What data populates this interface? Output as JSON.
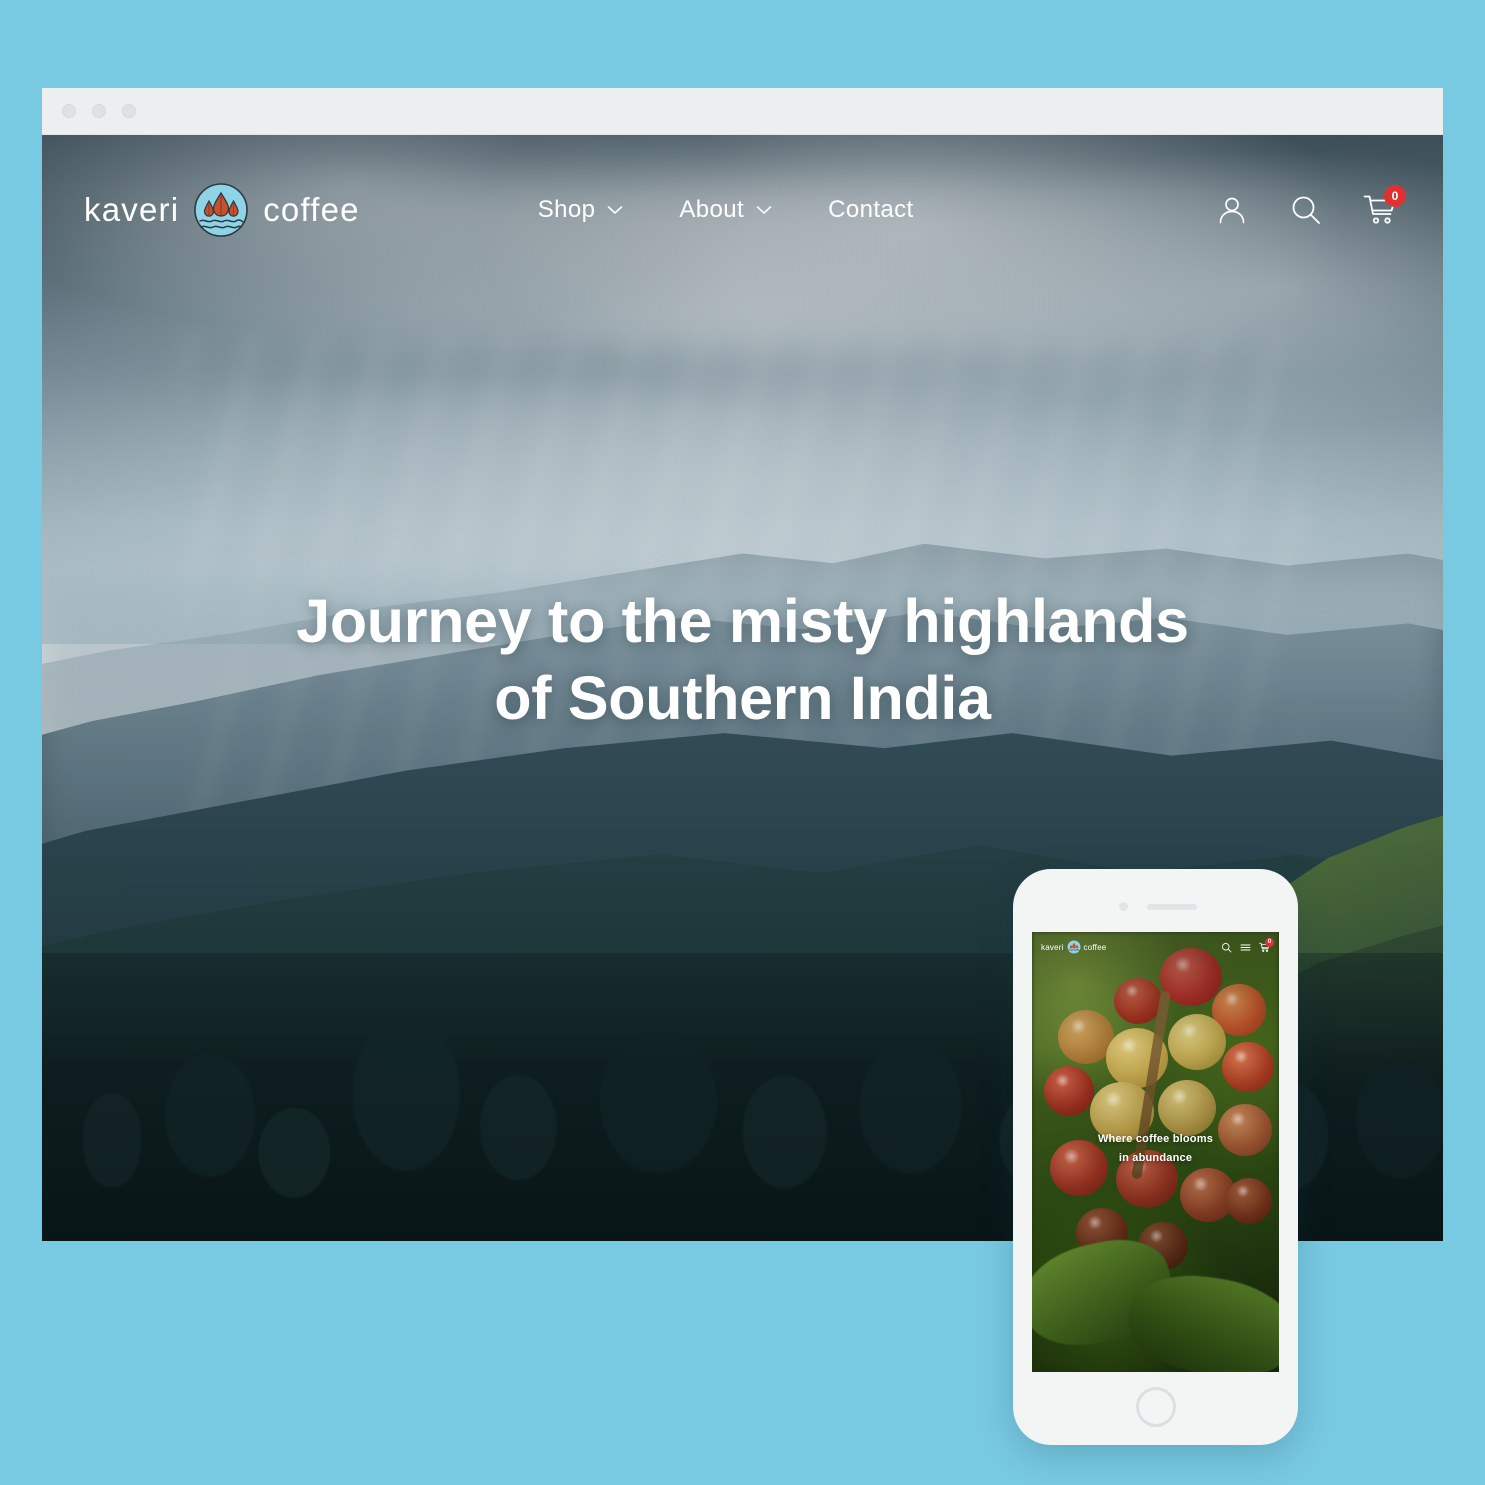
{
  "page": {
    "background_color": "#78c9e2"
  },
  "browser": {
    "window_dots": [
      "dot-1",
      "dot-2",
      "dot-3"
    ],
    "chrome_color": "#eceef0"
  },
  "desktop": {
    "brand": {
      "word_left": "kaveri",
      "word_right": "coffee",
      "logo_icon": "water-droplet-leaf-circle-logo",
      "logo_circle_color": "#8ed3e6",
      "logo_leaf_color": "#c8502b"
    },
    "nav": {
      "items": [
        {
          "label": "Shop",
          "has_dropdown": true,
          "icon": "chevron-down-icon"
        },
        {
          "label": "About",
          "has_dropdown": true,
          "icon": "chevron-down-icon"
        },
        {
          "label": "Contact",
          "has_dropdown": false,
          "icon": ""
        }
      ],
      "icons": [
        {
          "name": "account-icon",
          "label": "Account"
        },
        {
          "name": "search-icon",
          "label": "Search"
        },
        {
          "name": "cart-icon",
          "label": "Cart"
        }
      ],
      "cart_badge_count": "0",
      "cart_badge_color": "#e03131"
    },
    "hero": {
      "headline_line1": "Journey to the misty highlands",
      "headline_line2": "of Southern India",
      "image_alt": "misty blue mountain highlands with forested slopes and sun rays",
      "text_color": "#ffffff"
    }
  },
  "mobile": {
    "brand": {
      "word_left": "kaveri",
      "word_right": "coffee",
      "logo_icon": "water-droplet-leaf-circle-logo"
    },
    "nav": {
      "icons": [
        {
          "name": "search-icon",
          "label": "Search"
        },
        {
          "name": "hamburger-menu-icon",
          "label": "Menu"
        },
        {
          "name": "cart-icon",
          "label": "Cart"
        }
      ],
      "cart_badge_count": "0"
    },
    "hero": {
      "headline_line1": "Where coffee blooms",
      "headline_line2": "in abundance",
      "image_alt": "close-up of ripe red and yellow coffee cherries on a branch"
    },
    "device": {
      "camera": "front-camera-dot",
      "speaker": "earpiece-speaker",
      "home_button": "home-button"
    }
  }
}
